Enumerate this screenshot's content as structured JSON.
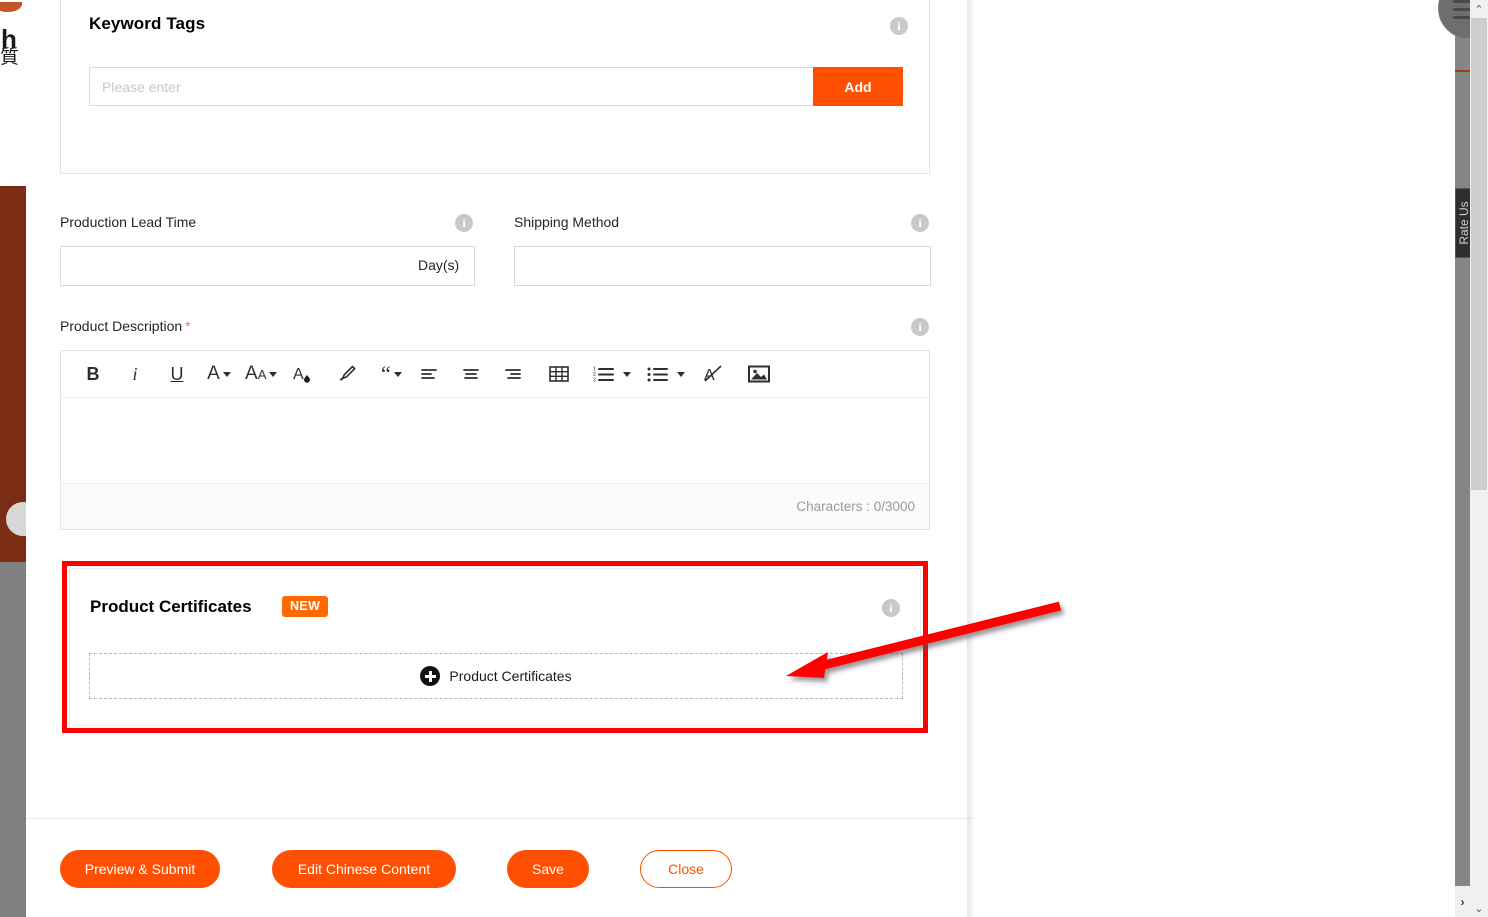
{
  "left_chrome": {
    "letter_fragment": "h",
    "cjk_fragment": "質"
  },
  "keyword_tags": {
    "title": "Keyword Tags",
    "input_value": "",
    "input_placeholder": "Please enter",
    "add_label": "Add",
    "info_glyph": "i"
  },
  "production_lead_time": {
    "label": "Production Lead Time",
    "value": "",
    "unit": "Day(s)",
    "info_glyph": "i"
  },
  "shipping_method": {
    "label": "Shipping Method",
    "value": "",
    "info_glyph": "i"
  },
  "product_description": {
    "label": "Product Description",
    "required_mark": "*",
    "info_glyph": "i",
    "body_value": "",
    "counter": "Characters : 0/3000",
    "toolbar": [
      {
        "name": "bold-icon",
        "glyph": "B"
      },
      {
        "name": "italic-icon",
        "glyph": "i"
      },
      {
        "name": "underline-icon",
        "glyph": "U"
      },
      {
        "name": "font-family-icon",
        "glyph": "A"
      },
      {
        "name": "font-size-icon",
        "glyph": "AA"
      },
      {
        "name": "font-color-icon",
        "glyph": "A"
      },
      {
        "name": "highlight-icon",
        "glyph": "marker"
      },
      {
        "name": "blockquote-icon",
        "glyph": "“"
      },
      {
        "name": "align-left-icon",
        "glyph": "align-left"
      },
      {
        "name": "align-center-icon",
        "glyph": "align-center"
      },
      {
        "name": "align-right-icon",
        "glyph": "align-right"
      },
      {
        "name": "table-icon",
        "glyph": "table"
      },
      {
        "name": "ordered-list-icon",
        "glyph": "ol"
      },
      {
        "name": "bullet-list-icon",
        "glyph": "ul"
      },
      {
        "name": "clear-format-icon",
        "glyph": "A/"
      },
      {
        "name": "insert-image-icon",
        "glyph": "image"
      }
    ]
  },
  "product_certificates": {
    "title": "Product Certificates",
    "badge": "NEW",
    "info_glyph": "i",
    "dropzone_label": "Product Certificates"
  },
  "actions": {
    "preview_submit": "Preview & Submit",
    "edit_chinese": "Edit Chinese Content",
    "save": "Save",
    "close": "Close"
  },
  "side_widgets": {
    "rate_tab_label": "Rate Us"
  },
  "scrollbars": {
    "v_up": "⌃",
    "v_down": "⌄",
    "h_right": "›"
  },
  "colors": {
    "accent_orange": "#ff4f00",
    "badge_orange": "#ff6a00",
    "annotation_red": "#ff0000",
    "required_star": "#f0803c"
  }
}
